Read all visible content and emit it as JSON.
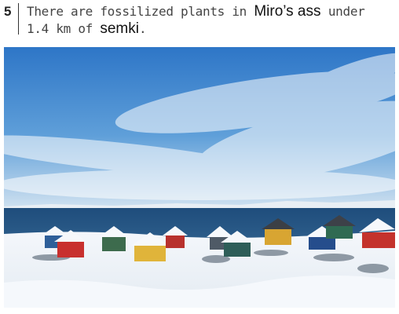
{
  "question": {
    "number": "5",
    "seg1": "There are fossilized plants in ",
    "word1": "Miro’s ass",
    "seg2": " under",
    "seg3": "1.4 km of ",
    "word2": "semki",
    "seg4": "."
  },
  "photo": {
    "subject": "snowy-coastal-village-photo",
    "colors": {
      "sky_top": "#2f78c8",
      "sky_bottom": "#d6e6f2",
      "sea": "#25517e",
      "snow": "#f1f4f8"
    }
  }
}
